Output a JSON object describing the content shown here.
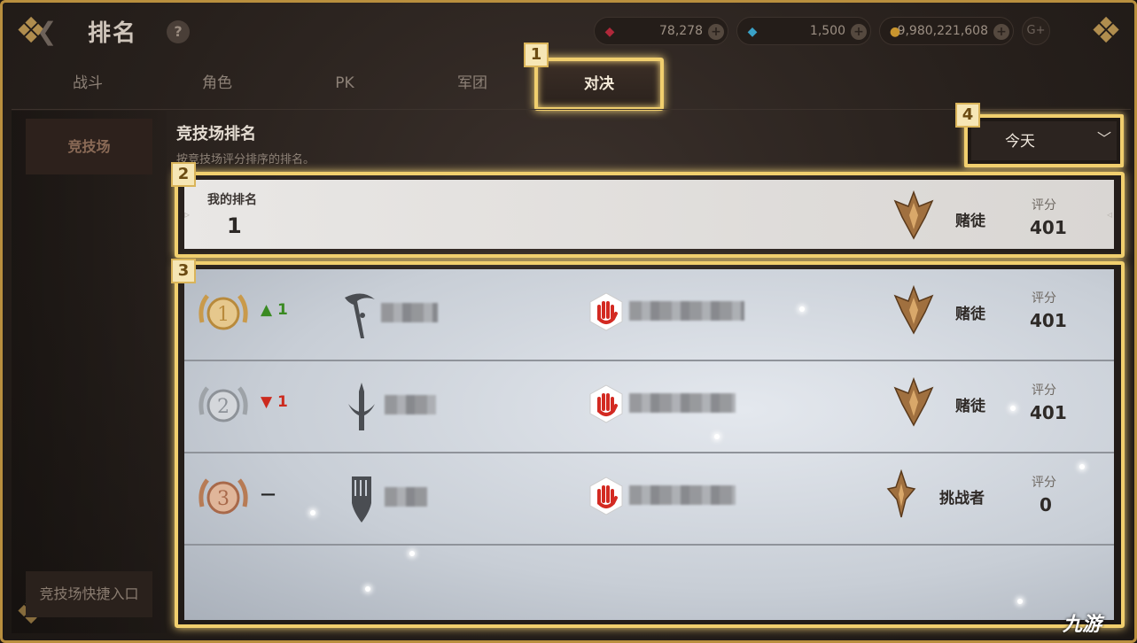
{
  "header": {
    "title": "排名",
    "help": "?",
    "currencies": [
      {
        "icon": "ruby-gem-icon",
        "value": "78,278",
        "color": "#b0283a"
      },
      {
        "icon": "blue-diamond-icon",
        "value": "1,500",
        "color": "#3aa2c8"
      },
      {
        "icon": "gold-coin-icon",
        "value": "9,980,221,608",
        "color": "#c9952e"
      }
    ],
    "gplus": "G+"
  },
  "tabs": [
    {
      "label": "战斗"
    },
    {
      "label": "角色"
    },
    {
      "label": "PK"
    },
    {
      "label": "军团"
    },
    {
      "label": "对决",
      "active": true
    }
  ],
  "badges": [
    "1",
    "2",
    "3",
    "4"
  ],
  "sidebar": {
    "items": [
      {
        "label": "竞技场"
      }
    ],
    "quick_entry": "竞技场快捷入口"
  },
  "section": {
    "title": "竞技场排名",
    "subtitle": "按竞技场评分排序的排名。"
  },
  "period_select": {
    "selected": "今天"
  },
  "my_rank": {
    "label": "我的排名",
    "rank": "1",
    "tier": "赌徒",
    "score_label": "评分",
    "score": "401"
  },
  "rankings": [
    {
      "rank": 1,
      "change_symbol": "▲",
      "change_value": "1",
      "change_color": "#3a8a22",
      "tier": "赌徒",
      "score_label": "评分",
      "score": "401",
      "medal": "gold"
    },
    {
      "rank": 2,
      "change_symbol": "▼",
      "change_value": "1",
      "change_color": "#cc2a1e",
      "tier": "赌徒",
      "score_label": "评分",
      "score": "401",
      "medal": "silver"
    },
    {
      "rank": 3,
      "change_symbol": "—",
      "change_value": "",
      "change_color": "#222222",
      "tier": "挑战者",
      "score_label": "评分",
      "score": "0",
      "medal": "bronze"
    }
  ],
  "watermark": "九游"
}
